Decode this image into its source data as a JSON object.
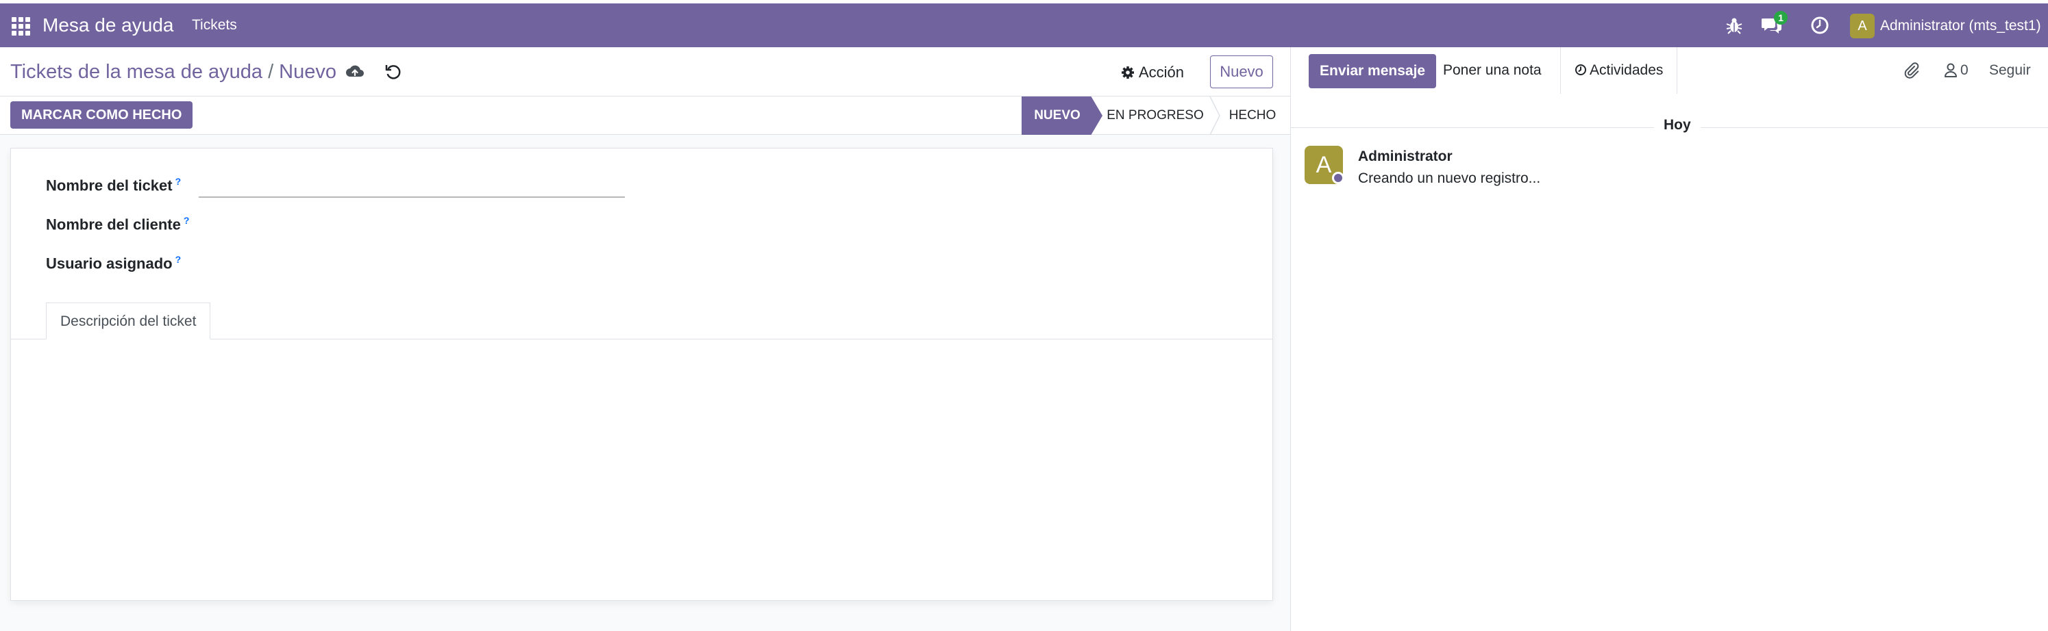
{
  "navbar": {
    "brand": "Mesa de ayuda",
    "menu": [
      "Tickets"
    ],
    "messages_badge": "1",
    "user_initial": "A",
    "user_name": "Administrator (mts_test1)",
    "color": "#71639e"
  },
  "control_panel": {
    "breadcrumb_parent": "Tickets de la mesa de ayuda",
    "breadcrumb_separator": "/",
    "breadcrumb_current": "Nuevo",
    "action_label": "Acción",
    "new_label": "Nuevo"
  },
  "statusbar": {
    "done_button": "MARCAR COMO HECHO",
    "stages": [
      "NUEVO",
      "EN PROGRESO",
      "HECHO"
    ],
    "active_stage": "NUEVO"
  },
  "form": {
    "fields": [
      {
        "label": "Nombre del ticket",
        "help": "?",
        "value": ""
      },
      {
        "label": "Nombre del cliente",
        "help": "?"
      },
      {
        "label": "Usuario asignado",
        "help": "?"
      }
    ],
    "tabs": [
      "Descripción del ticket"
    ]
  },
  "chatter": {
    "send_message": "Enviar mensaje",
    "log_note": "Poner una nota",
    "activities": "Actividades",
    "followers_count": "0",
    "follow": "Seguir",
    "date_separator": "Hoy",
    "messages": [
      {
        "initial": "A",
        "author": "Administrator",
        "body": "Creando un nuevo registro..."
      }
    ]
  },
  "icons": {
    "apps": "apps-grid-icon",
    "bug": "bug-icon",
    "chat": "chat-icon",
    "clock": "clock-icon",
    "save": "cloud-upload-icon",
    "discard": "undo-icon",
    "gear": "gear-icon",
    "paperclip": "paperclip-icon",
    "person": "person-icon"
  }
}
